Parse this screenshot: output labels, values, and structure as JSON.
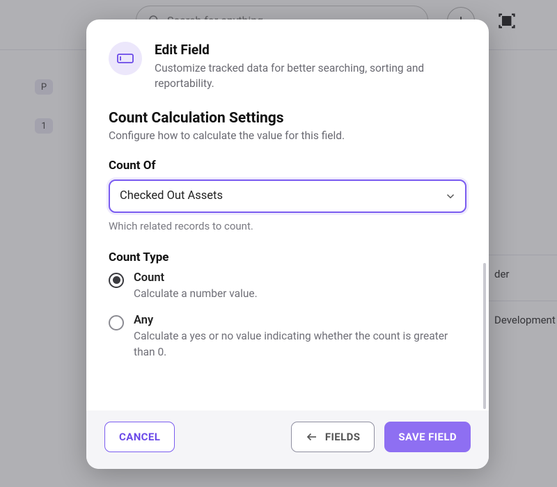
{
  "background": {
    "search_placeholder": "Search for anything...",
    "sidebar_badges": [
      "P",
      "1"
    ],
    "row1": "der",
    "row2": "Development"
  },
  "modal": {
    "header": {
      "title": "Edit Field",
      "subtitle": "Customize tracked data for better searching, sorting and reportability."
    },
    "section": {
      "title": "Count Calculation Settings",
      "subtitle": "Configure how to calculate the value for this field."
    },
    "count_of": {
      "label": "Count Of",
      "value": "Checked Out Assets",
      "help": "Which related records to count."
    },
    "count_type": {
      "label": "Count Type",
      "options": [
        {
          "label": "Count",
          "desc": "Calculate a number value.",
          "selected": true
        },
        {
          "label": "Any",
          "desc": "Calculate a yes or no value indicating whether the count is greater than 0.",
          "selected": false
        }
      ]
    },
    "footer": {
      "cancel": "CANCEL",
      "fields": "FIELDS",
      "save": "SAVE FIELD"
    }
  },
  "icons": {
    "field": "field-icon",
    "search": "search-icon",
    "plus": "plus-icon",
    "scan": "scan-icon",
    "chevron_down": "chevron-down-icon",
    "arrow_left": "arrow-left-icon"
  },
  "colors": {
    "accent": "#7a5cf0",
    "accent_fill": "#8e6ff2",
    "icon_bg": "#ece7fb",
    "muted": "#6a6a72"
  }
}
